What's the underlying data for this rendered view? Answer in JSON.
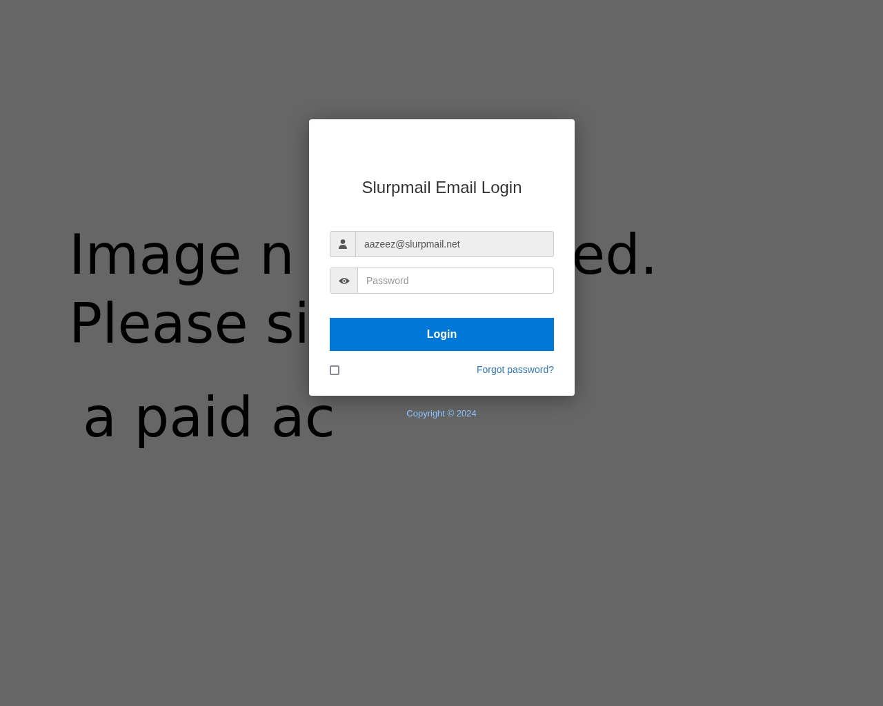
{
  "background_image": {
    "lines": [
      {
        "text": "Image n"
      },
      {
        "text": "ed."
      },
      {
        "text": "Please si"
      },
      {
        "text": "a paid ac"
      }
    ]
  },
  "login": {
    "title": "Slurpmail Email Login",
    "email_field": {
      "value": "aazeez@slurpmail.net"
    },
    "password_field": {
      "placeholder": "Password"
    },
    "login_button": "Login",
    "remember_checkbox": {
      "checked": false
    },
    "forgot_link": "Forgot password?"
  },
  "footer": {
    "copyright": "Copyright © 2024"
  }
}
